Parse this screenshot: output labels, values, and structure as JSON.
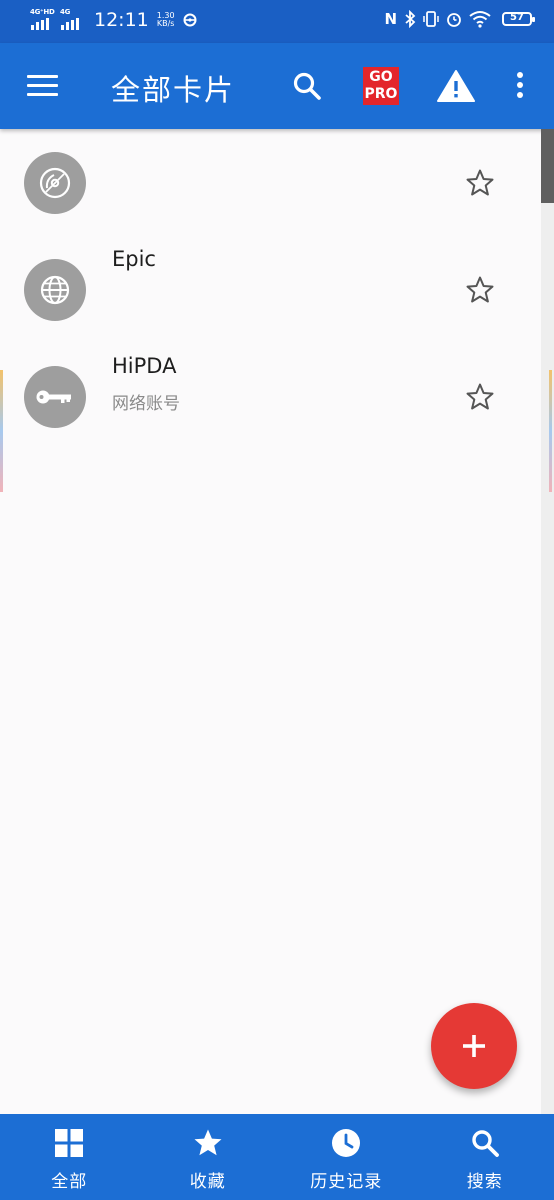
{
  "status_bar": {
    "sim1_label": "4G⁺HD",
    "sim2_label": "4G",
    "time": "12:11",
    "speed_value": "1.30",
    "speed_unit": "KB/s",
    "battery": "57"
  },
  "app_bar": {
    "title": "全部卡片",
    "gopro_line1": "GO",
    "gopro_line2": "PRO"
  },
  "cards": [
    {
      "title": "",
      "subtitle": "",
      "icon": "disc-icon",
      "starred": false
    },
    {
      "title": "Epic",
      "subtitle": "",
      "icon": "globe-icon",
      "starred": false
    },
    {
      "title": "HiPDA",
      "subtitle": "网络账号",
      "icon": "key-icon",
      "starred": false
    }
  ],
  "bottom_nav": [
    {
      "label": "全部",
      "icon": "grid-icon"
    },
    {
      "label": "收藏",
      "icon": "star-icon"
    },
    {
      "label": "历史记录",
      "icon": "clock-icon"
    },
    {
      "label": "搜索",
      "icon": "search-icon"
    }
  ],
  "colors": {
    "primary": "#1c6ed4",
    "status_bar": "#1a5fc4",
    "fab": "#e53935",
    "gopro": "#e3262b",
    "avatar": "#9e9e9e"
  }
}
